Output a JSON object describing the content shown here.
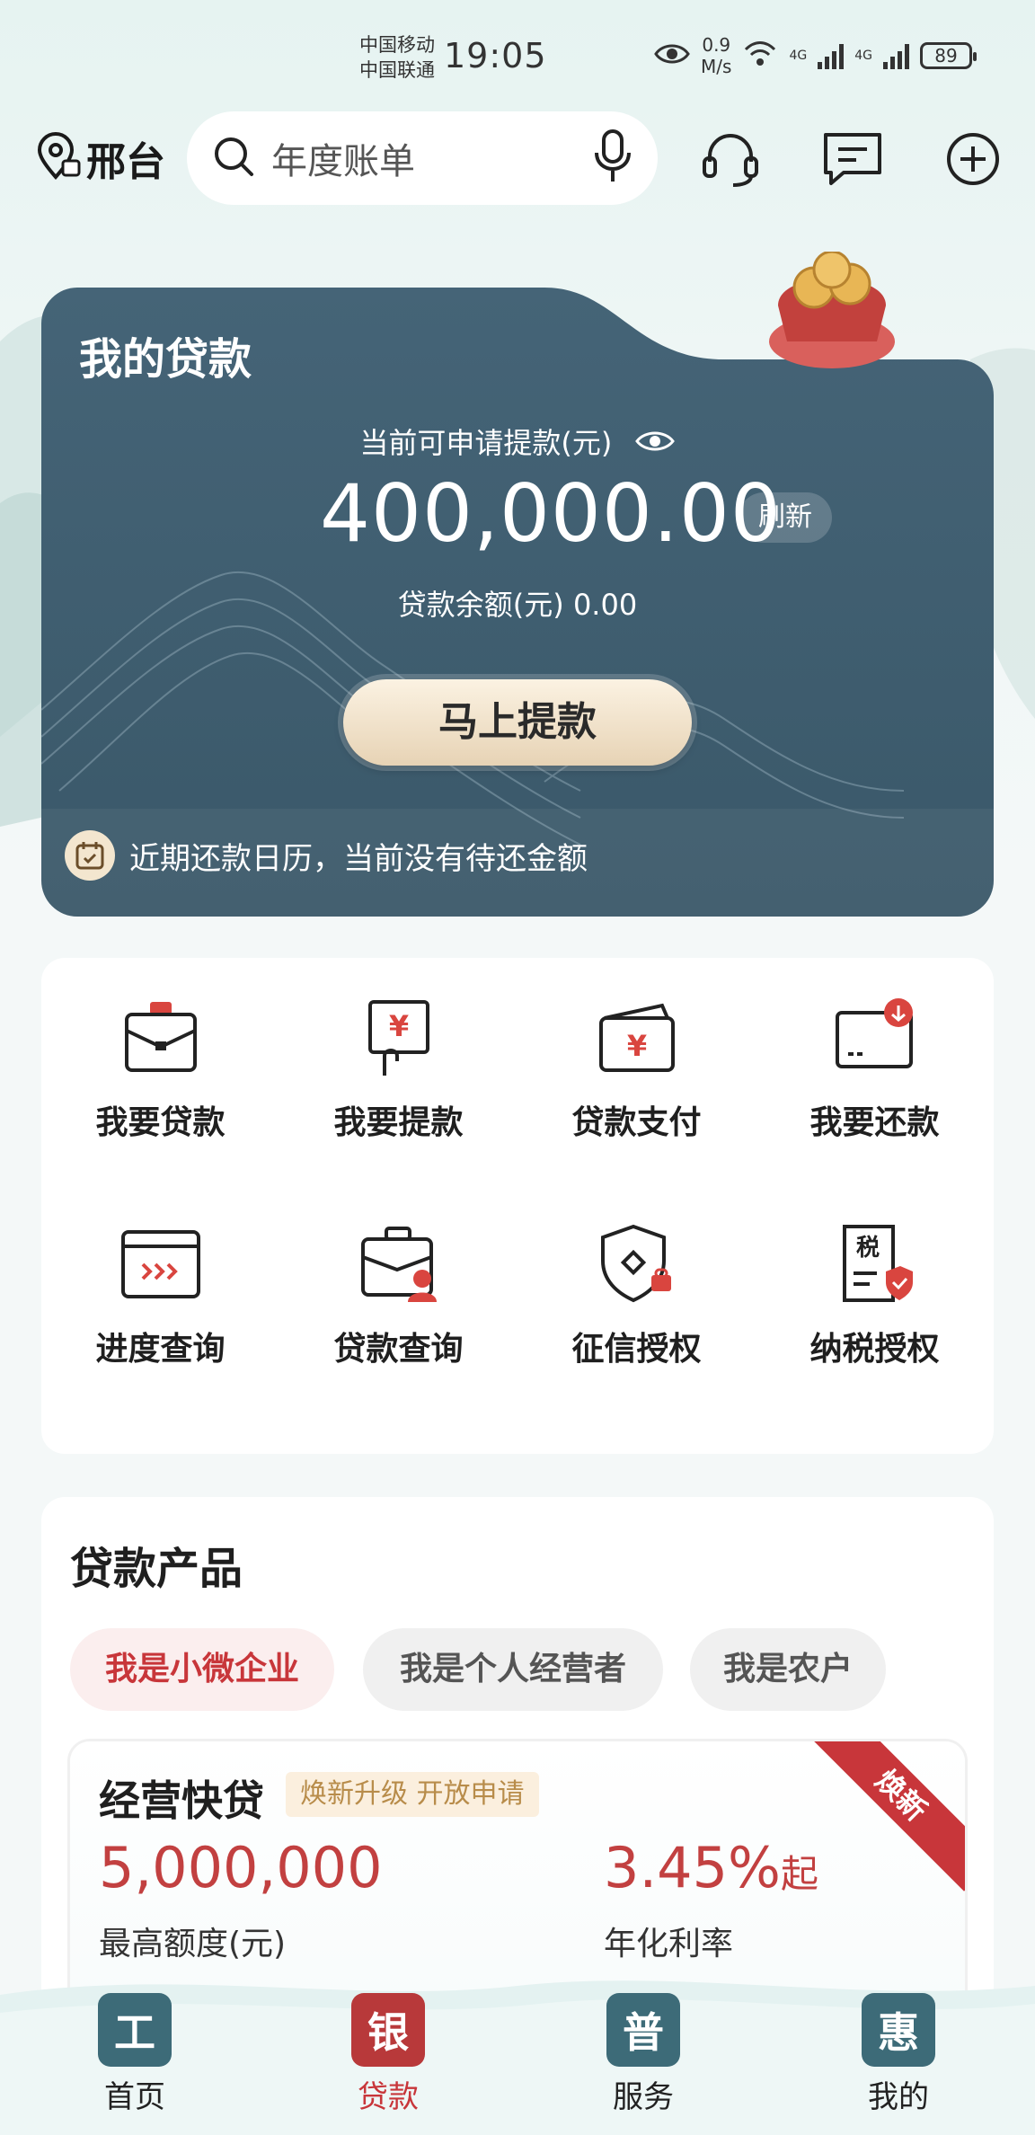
{
  "status_bar": {
    "carrier1": "中国移动",
    "carrier2": "中国联通",
    "time": "19:05",
    "net_speed_value": "0.9",
    "net_speed_unit": "M/s",
    "net_type1": "4G",
    "net_type2": "4G",
    "battery": "89"
  },
  "header": {
    "location": "邢台",
    "search_placeholder": "年度账单"
  },
  "loan_card": {
    "title": "我的贷款",
    "available_label": "当前可申请提款(元)",
    "available_amount": "400,000.00",
    "refresh_label": "刷新",
    "balance_text": "贷款余额(元) 0.00",
    "withdraw_button": "马上提款",
    "calendar_text": "近期还款日历，当前没有待还金额"
  },
  "services": [
    {
      "label": "我要贷款",
      "icon": "briefcase-icon"
    },
    {
      "label": "我要提款",
      "icon": "withdraw-yen-icon"
    },
    {
      "label": "贷款支付",
      "icon": "wallet-yen-icon"
    },
    {
      "label": "我要还款",
      "icon": "card-repay-icon"
    },
    {
      "label": "进度查询",
      "icon": "progress-icon"
    },
    {
      "label": "贷款查询",
      "icon": "loan-query-icon"
    },
    {
      "label": "征信授权",
      "icon": "credit-shield-icon"
    },
    {
      "label": "纳税授权",
      "icon": "tax-doc-icon"
    }
  ],
  "products": {
    "title": "贷款产品",
    "chips": [
      "我是小微企业",
      "我是个人经营者",
      "我是农户"
    ],
    "active_chip": 0,
    "item": {
      "name": "经营快贷",
      "tag": "焕新升级 开放申请",
      "ribbon": "焕新",
      "max_amount": "5,000,000",
      "max_amount_label": "最高额度(元)",
      "rate": "3.45%",
      "rate_suffix": "起",
      "rate_label": "年化利率"
    }
  },
  "bottom_nav": [
    {
      "glyph": "工",
      "label": "首页",
      "color": "#3d6b78"
    },
    {
      "glyph": "银",
      "label": "贷款",
      "color": "#b8393a"
    },
    {
      "glyph": "普",
      "label": "服务",
      "color": "#3d6b78"
    },
    {
      "glyph": "惠",
      "label": "我的",
      "color": "#3d6b78"
    }
  ],
  "colors": {
    "accent_red": "#c8363a",
    "card_teal": "#3f5e70",
    "gold": "#e7d3b5"
  }
}
